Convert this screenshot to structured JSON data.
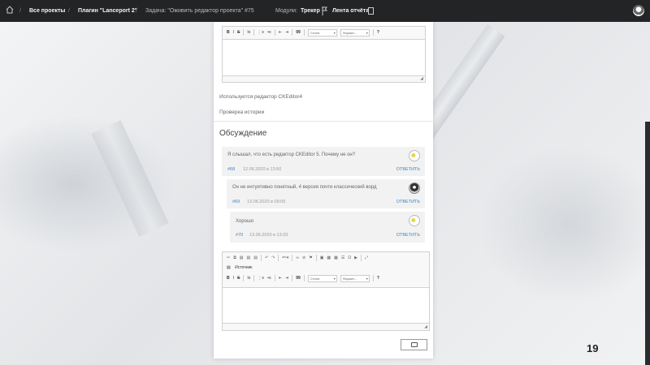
{
  "nav": {
    "all_projects": "Все проекты",
    "plugin": "Плагин \"Lanceport 2\"",
    "task": "Задача: \"Оживить редактор проекта\" #75",
    "module_label": "Модули:",
    "tracker": "Трекер",
    "report_feed": "Лента отчёта",
    "separator": "/"
  },
  "editor": {
    "bold": "B",
    "italic": "I",
    "strike": "S",
    "clear": "Ix",
    "quote": "99",
    "help": "?",
    "styles": "Стили",
    "format": "Формат...",
    "source": "Источник"
  },
  "panel": {
    "info_editor": "Используется редактор CKEditor4",
    "history": "Проверка истории",
    "discussion_title": "Обсуждение"
  },
  "comments": [
    {
      "text": "Я слышал, что есть редактор CKEditor 5. Почему не он?",
      "id": "#68",
      "date": "12.06.2020 в 13:50",
      "reply": "ОТВЕТИТЬ"
    },
    {
      "text": "Он не интуитивно понятный, 4 версия почти классический ворд",
      "id": "#69",
      "date": "13.06.2020 в 09:05",
      "reply": "ОТВЕТИТЬ"
    },
    {
      "text": "Хорошо",
      "id": "#70",
      "date": "13.06.2020 в 13:33",
      "reply": "ОТВЕТИТЬ"
    }
  ],
  "slide_number": "19"
}
